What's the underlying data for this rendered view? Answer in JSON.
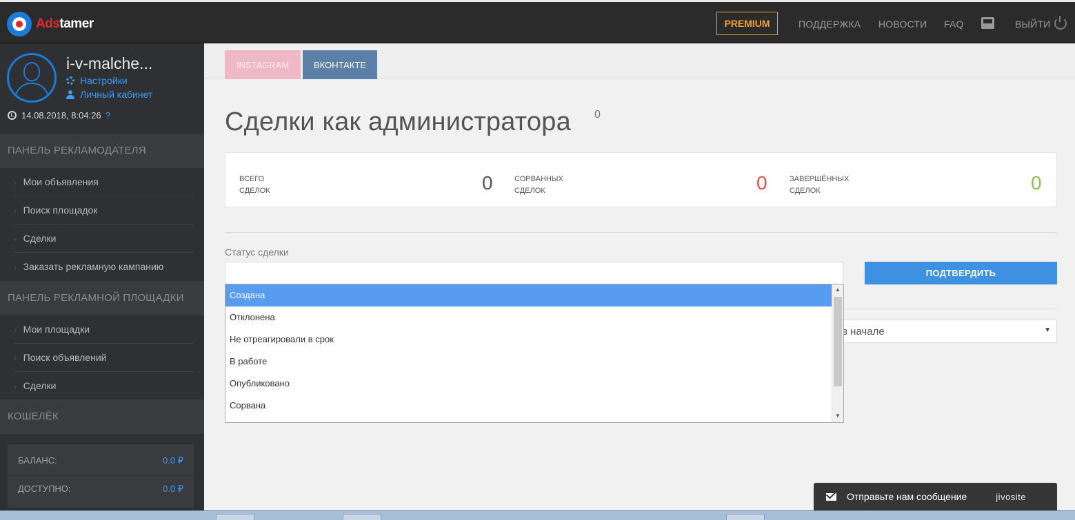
{
  "header": {
    "logo_ads": "Ads",
    "logo_tamer": "tamer",
    "premium_label": "PREMIUM",
    "nav": [
      "ПОДДЕРЖКА",
      "НОВОСТИ",
      "FAQ"
    ],
    "logout_label": "ВЫЙТИ"
  },
  "user": {
    "name": "i-v-malche...",
    "settings_link": "Настройки",
    "cabinet_link": "Личный кабинет",
    "datetime": "14.08.2018, 8:04:26",
    "help": "?"
  },
  "sidebar": {
    "advertiser_panel": "ПАНЕЛЬ РЕКЛАМОДАТЕЛЯ",
    "advertiser_items": [
      "Мои объявления",
      "Поиск площадок",
      "Сделки",
      "Заказать рекламную кампанию"
    ],
    "platform_panel": "ПАНЕЛЬ РЕКЛАМНОЙ ПЛОЩАДКИ",
    "platform_items": [
      "Мои площадки",
      "Поиск объявлений",
      "Сделки"
    ],
    "wallet_panel": "КОШЕЛЁК",
    "balance_label": "БАЛАНС:",
    "balance_value": "0.0 ₽",
    "available_label": "ДОСТУПНО:",
    "available_value": "0.0 ₽"
  },
  "tabs": [
    "INSTAGRAM",
    "ВКОНТАКТЕ"
  ],
  "page": {
    "title": "Сделки как администратора",
    "title_count": "0"
  },
  "stats": {
    "total_label_1": "ВСЕГО",
    "total_label_2": "СДЕЛОК",
    "total_value": "0",
    "failed_label_1": "СОРВАННЫХ",
    "failed_label_2": "СДЕЛОК",
    "failed_value": "0",
    "done_label_1": "ЗАВЕРШЁННЫХ",
    "done_label_2": "СДЕЛОК",
    "done_value": "0",
    "colors": {
      "total": "#555555",
      "failed": "#e05050",
      "done": "#8bc34a"
    }
  },
  "filter": {
    "status_label": "Статус сделки",
    "status_value": "",
    "confirm_label": "ПОДТВЕРДИТЬ",
    "sort_value": "в начале",
    "options": [
      "Создана",
      "Отклонена",
      "Не отреагировали в срок",
      "В работе",
      "Опубликовано",
      "Сорвана"
    ],
    "selected_option": "Создана"
  },
  "chat": {
    "text": "Отправьте нам сообщение",
    "brand": "jivosite"
  },
  "colors": {
    "accent": "#3e91e0",
    "premium": "#f0a030",
    "sidebar_bg": "#2f3033",
    "topbar_bg": "#2b2b2b"
  }
}
